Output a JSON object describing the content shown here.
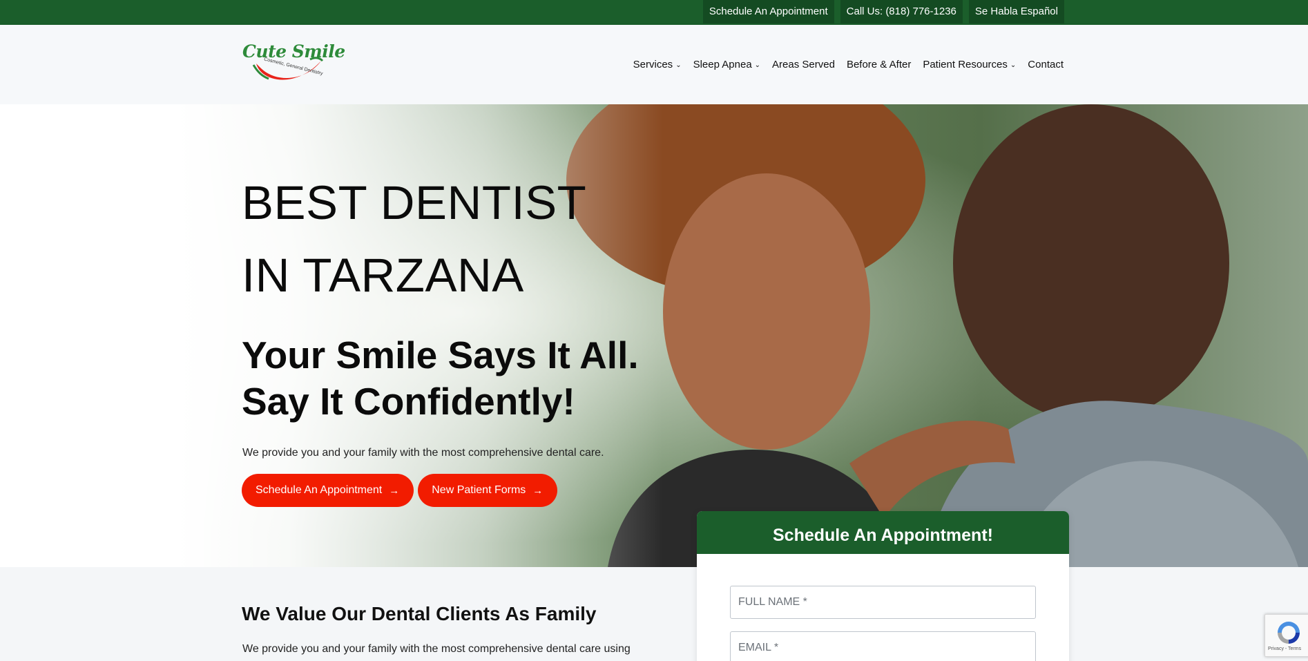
{
  "topbar": {
    "links": [
      "Schedule An Appointment",
      "Call Us: (818) 776-1236",
      "Se Habla Español"
    ]
  },
  "header": {
    "logo": {
      "text": "Cute Smile",
      "tagline": "Cosmetic, General Dentistry"
    },
    "nav": [
      {
        "label": "Services",
        "dropdown": true
      },
      {
        "label": "Sleep Apnea",
        "dropdown": true
      },
      {
        "label": "Areas Served",
        "dropdown": false
      },
      {
        "label": "Before & After",
        "dropdown": false
      },
      {
        "label": "Patient Resources",
        "dropdown": true
      },
      {
        "label": "Contact",
        "dropdown": false
      }
    ],
    "chevron": "⌄"
  },
  "hero": {
    "title_line1": "BEST DENTIST",
    "title_line2": "IN TARZANA",
    "subtitle_line1": "Your Smile Says It All.",
    "subtitle_line2": "Say It Confidently!",
    "text": "We provide you and your family with the most comprehensive dental care.",
    "buttons": [
      {
        "label": "Schedule An Appointment",
        "icon": "arrow-right-icon"
      },
      {
        "label": "New Patient Forms",
        "icon": "arrow-right-icon"
      }
    ],
    "arrow": "→"
  },
  "section": {
    "title": "We Value Our Dental Clients As Family",
    "text": "We provide you and your family with the most comprehensive dental care using"
  },
  "form": {
    "title": "Schedule An Appointment!",
    "fields": [
      {
        "placeholder": "FULL NAME *"
      },
      {
        "placeholder": "EMAIL *"
      }
    ]
  },
  "recaptcha": {
    "text": "Privacy - Terms"
  },
  "colors": {
    "brand_green": "#1b5e2b",
    "accent_red": "#f21c00",
    "logo_green": "#2e8b3a"
  }
}
